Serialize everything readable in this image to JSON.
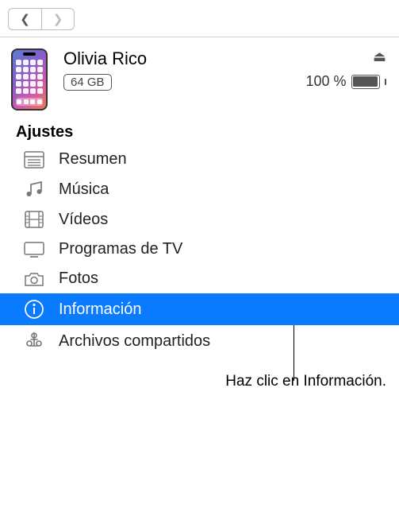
{
  "nav": {
    "back_glyph": "❮",
    "fwd_glyph": "❯"
  },
  "device": {
    "name": "Olivia Rico",
    "storage": "64 GB",
    "battery_text": "100 %",
    "eject_glyph": "⏏"
  },
  "sidebar": {
    "heading": "Ajustes",
    "items": [
      {
        "label": "Resumen",
        "selected": false
      },
      {
        "label": "Música",
        "selected": false
      },
      {
        "label": "Vídeos",
        "selected": false
      },
      {
        "label": "Programas de TV",
        "selected": false
      },
      {
        "label": "Fotos",
        "selected": false
      },
      {
        "label": "Información",
        "selected": true
      },
      {
        "label": "Archivos compartidos",
        "selected": false
      }
    ]
  },
  "callout": "Haz clic en Información."
}
